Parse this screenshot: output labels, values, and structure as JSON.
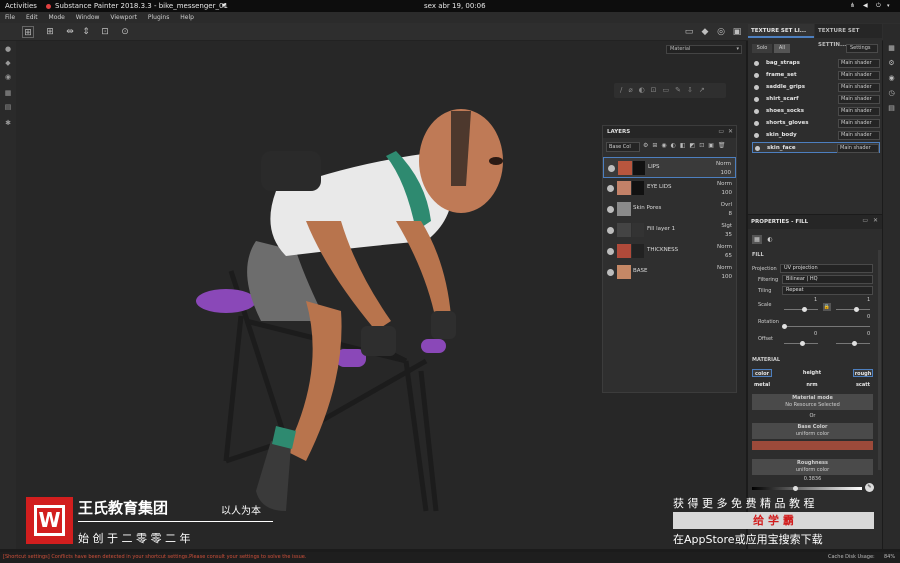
{
  "topbar": {
    "activities": "Activities",
    "app_title": "Substance Painter 2018.3.3 - bike_messenger_01",
    "clock": "sex abr 19, 00:06"
  },
  "menu": [
    "File",
    "Edit",
    "Mode",
    "Window",
    "Viewport",
    "Plugins",
    "Help"
  ],
  "viewport": {
    "material_dropdown": "Material"
  },
  "layers_panel": {
    "title": "LAYERS",
    "channel": "Base Col",
    "layers": [
      {
        "name": "LIPS",
        "blend": "Norm",
        "opacity": "100"
      },
      {
        "name": "EYE LIDS",
        "blend": "Norm",
        "opacity": "100"
      },
      {
        "name": "Skin Pores",
        "blend": "Ovrl",
        "opacity": "8"
      },
      {
        "name": "Fill layer 1",
        "blend": "Slgt",
        "opacity": "35"
      },
      {
        "name": "THICKNESS",
        "blend": "Norm",
        "opacity": "65"
      },
      {
        "name": "BASE",
        "blend": "Norm",
        "opacity": "100"
      }
    ]
  },
  "texture_sets": {
    "tab1": "TEXTURE SET LI...",
    "tab2": "TEXTURE SET SETTIN...",
    "solo": "Solo",
    "all": "All",
    "settings": "Settings",
    "items": [
      {
        "name": "bag_straps",
        "shader": "Main shader"
      },
      {
        "name": "frame_set",
        "shader": "Main shader"
      },
      {
        "name": "saddle_grips",
        "shader": "Main shader"
      },
      {
        "name": "shirt_scarf",
        "shader": "Main shader"
      },
      {
        "name": "shoes_socks",
        "shader": "Main shader"
      },
      {
        "name": "shorts_gloves",
        "shader": "Main shader"
      },
      {
        "name": "skin_body",
        "shader": "Main shader"
      },
      {
        "name": "skin_face",
        "shader": "Main shader"
      }
    ]
  },
  "properties": {
    "title": "PROPERTIES - FILL",
    "fill": "FILL",
    "projection_label": "Projection",
    "projection": "UV projection",
    "filtering_label": "Filtering",
    "filtering": "Bilinear | HQ",
    "tiling_label": "Tiling",
    "tiling": "Repeat",
    "scale_label": "Scale",
    "scale_val": "1",
    "scale_val2": "1",
    "rotation_label": "Rotation",
    "rotation_val": "0",
    "offset_label": "Offset",
    "offset_val": "0",
    "offset_val2": "0",
    "material": "MATERIAL",
    "chips": [
      "color",
      "height",
      "rough",
      "metal",
      "nrm",
      "scatt"
    ],
    "material_mode": "Material mode",
    "no_resource": "No Resource Selected",
    "or": "Or",
    "base_color": "Base Color",
    "uniform_color": "uniform color",
    "roughness": "Roughness",
    "uniform_color2": "uniform color",
    "rough_value": "0.3836",
    "base_color_hex": "#9c4a3a"
  },
  "statusbar": {
    "message": "[Shortcut settings] Conflicts have been detected in your shortcut settings.Please consult your settings to solve the issue.",
    "cache": "Cache Disk Usage:",
    "cache_val": "84%"
  },
  "watermark": {
    "company": "王氏教育集团",
    "slogan": "以人为本",
    "founded": "始 创 于 二 零 零 二 年",
    "promo": "获 得 更 多 免 费 精 品 教 程",
    "app_name": "给 学 霸",
    "search": "在AppStore或应用宝搜索下载"
  }
}
